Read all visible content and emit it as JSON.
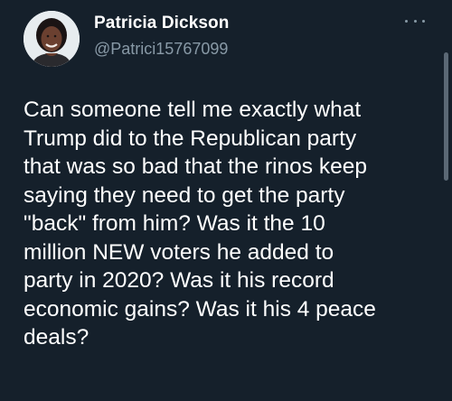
{
  "author": {
    "display_name": "Patricia Dickson",
    "handle": "@Patrici15767099",
    "avatar_icon": "avatar-photo-icon"
  },
  "menu": {
    "icon": "more-options-icon"
  },
  "tweet": {
    "lines": [
      "Can someone tell me exactly what",
      "Trump did to the Republican party",
      "that was so bad that the rinos keep",
      "saying they need to get the party",
      "\"back\" from him? Was it the 10",
      "million NEW voters he added to",
      "party in 2020? Was it his record",
      "economic gains? Was it his 4 peace",
      "deals?"
    ]
  },
  "colors": {
    "background": "#15202b",
    "text_primary": "#ffffff",
    "text_secondary": "#8899a6"
  }
}
